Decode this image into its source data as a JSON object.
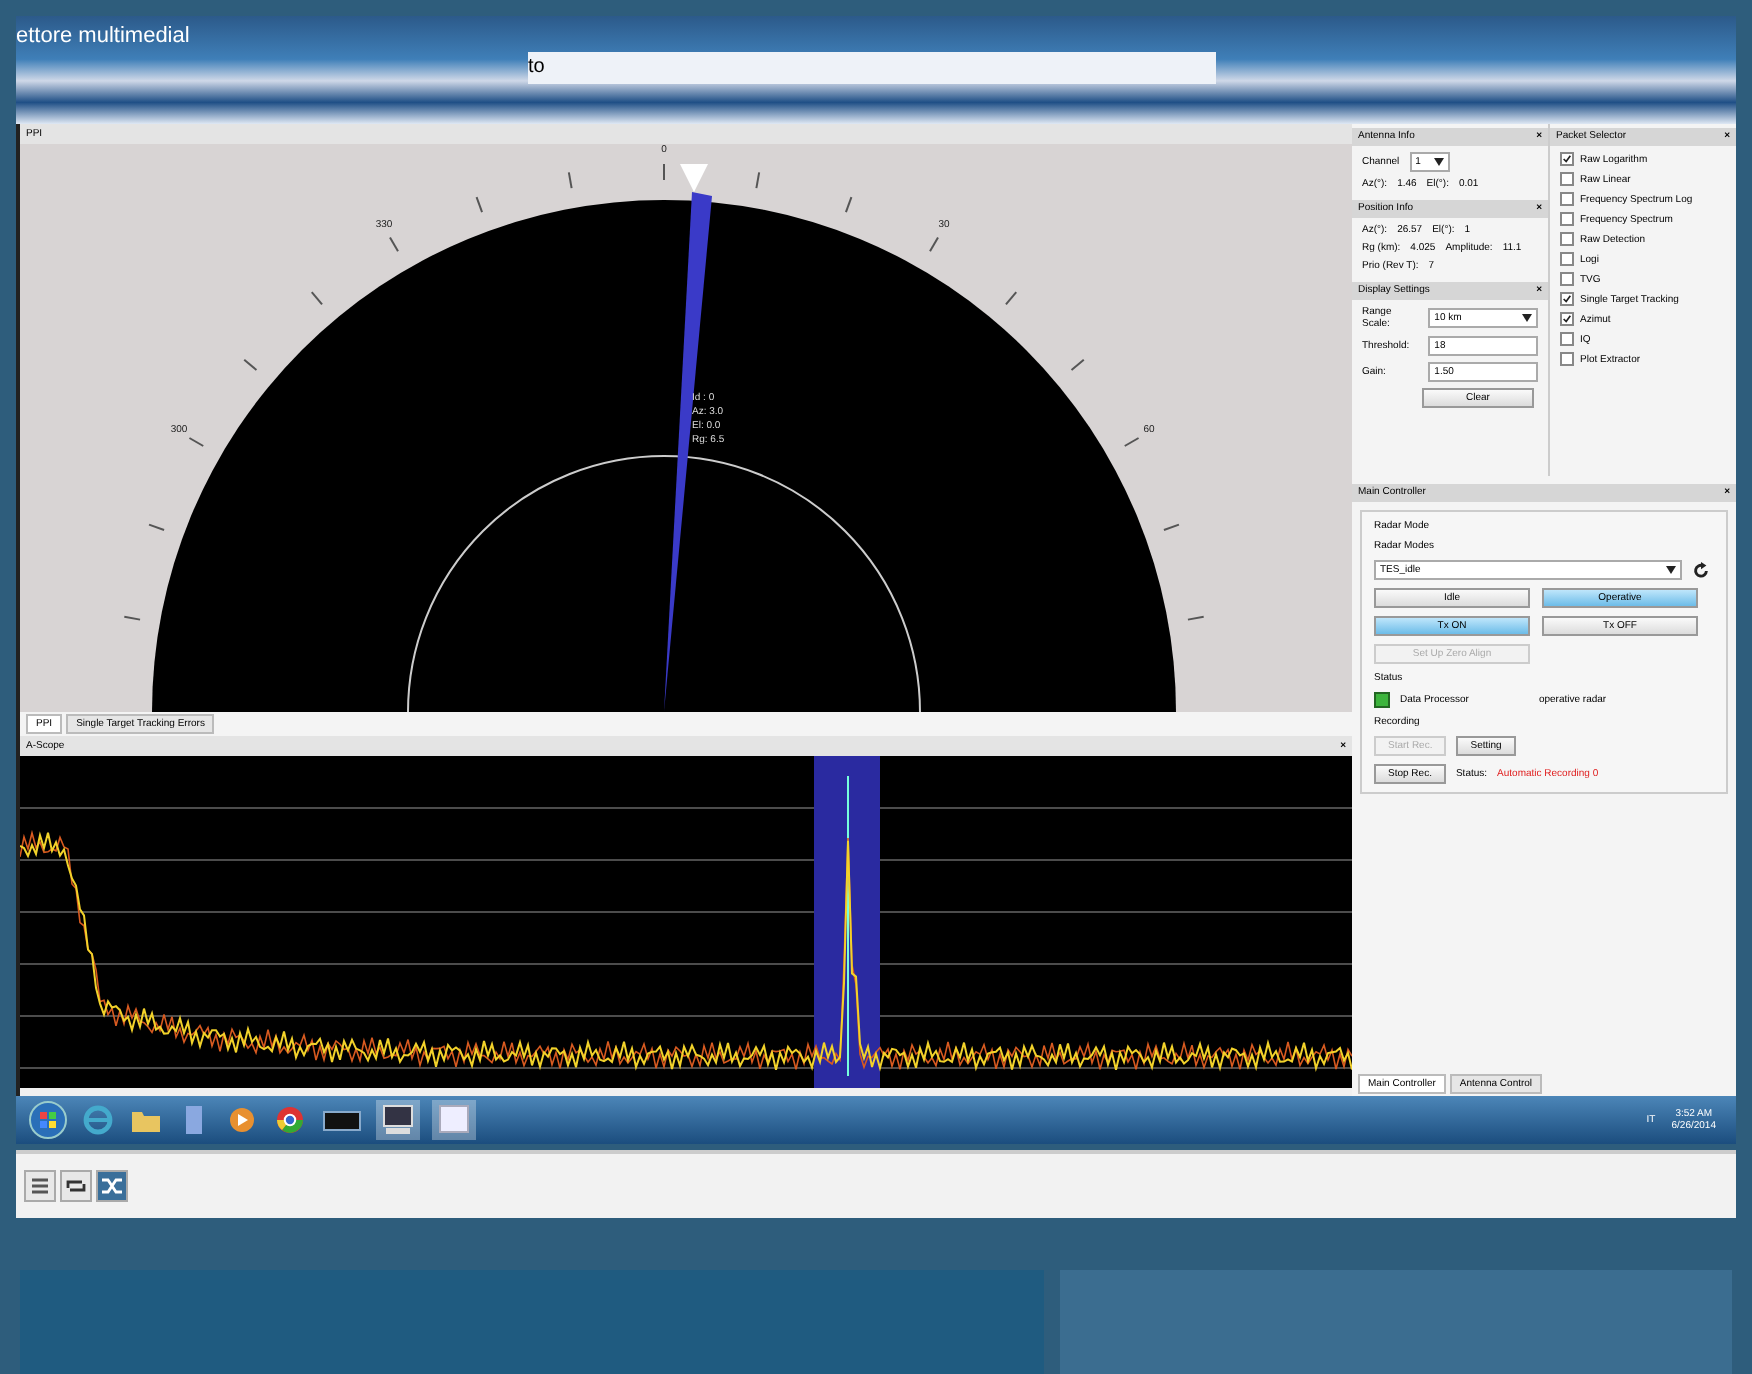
{
  "player": {
    "title": "ettore multimedial",
    "address": "to"
  },
  "ppi": {
    "title": "PPI",
    "bearings": [
      {
        "label": "0"
      },
      {
        "label": "330"
      },
      {
        "label": "30"
      },
      {
        "label": "300"
      },
      {
        "label": "60"
      }
    ],
    "target_info": [
      "Id : 0",
      "Az: 3.0",
      "El: 0.0",
      "Rg: 6.5"
    ],
    "tabs": [
      {
        "label": "PPI",
        "selected": true
      },
      {
        "label": "Single Target Tracking Errors",
        "selected": false
      }
    ]
  },
  "a_scope": {
    "title": "A-Scope",
    "close": "×"
  },
  "antenna_info": {
    "title": "Antenna Info",
    "close": "×",
    "channel_label": "Channel",
    "channel": "1",
    "az_label": "Az(°):",
    "az": "1.46",
    "el_label": "El(°):",
    "el": "0.01"
  },
  "position_info": {
    "title": "Position Info",
    "close": "×",
    "rows": [
      {
        "label": "Az(°):",
        "value": "26.57",
        "label2": "El(°):",
        "value2": "1"
      },
      {
        "label": "Rg (km):",
        "value": "4.025",
        "label2": "Amplitude:",
        "value2": "11.1"
      },
      {
        "label": "Prio (Rev T):",
        "value": "7",
        "label2": "",
        "value2": ""
      }
    ]
  },
  "display_settings": {
    "title": "Display Settings",
    "close": "×",
    "range_label": "Range Scale:",
    "range": "10 km",
    "threshold_label": "Threshold:",
    "threshold": "18",
    "gain_label": "Gain:",
    "gain": "1.50",
    "clear": "Clear"
  },
  "packet_selector": {
    "title": "Packet Selector",
    "close": "×",
    "items": [
      {
        "label": "Raw Logarithm",
        "checked": true
      },
      {
        "label": "Raw Linear",
        "checked": false
      },
      {
        "label": "Frequency Spectrum Log",
        "checked": false
      },
      {
        "label": "Frequency Spectrum",
        "checked": false
      },
      {
        "label": "Raw Detection",
        "checked": false
      },
      {
        "label": "Logi",
        "checked": false
      },
      {
        "label": "TVG",
        "checked": false
      },
      {
        "label": "Single Target Tracking",
        "checked": true
      },
      {
        "label": "Azimut",
        "checked": true
      },
      {
        "label": "IQ",
        "checked": false
      },
      {
        "label": "Plot Extractor",
        "checked": false
      }
    ]
  },
  "main_controller": {
    "title": "Main Controller",
    "close": "×",
    "group": "Radar Mode",
    "modes_label": "Radar Modes",
    "mode": "TES_idle",
    "buttons": [
      {
        "label": "Idle",
        "selected": false,
        "disabled": false
      },
      {
        "label": "Operative",
        "selected": true,
        "disabled": false
      },
      {
        "label": "Tx ON",
        "selected": true,
        "disabled": false
      },
      {
        "label": "Tx OFF",
        "selected": false,
        "disabled": false
      },
      {
        "label": "Set Up Zero Align",
        "selected": false,
        "disabled": true
      }
    ],
    "status_title": "Status",
    "status": {
      "label": "Data Processor",
      "color": "#3cb43c",
      "text": "operative radar"
    },
    "recording_title": "Recording",
    "rec_buttons": [
      {
        "label": "Start Rec.",
        "disabled": true
      },
      {
        "label": "Setting",
        "disabled": false
      },
      {
        "label": "Stop Rec.",
        "disabled": false
      }
    ],
    "rec_status_label": "Status:",
    "rec_status": "Automatic Recording 0"
  },
  "bottom_tabs": [
    {
      "label": "Main Controller",
      "selected": true
    },
    {
      "label": "Antenna Control",
      "selected": false
    }
  ],
  "taskbar": {
    "apps": [
      {
        "kind": "start"
      },
      {
        "kind": "browser"
      },
      {
        "kind": "folder"
      },
      {
        "kind": "document"
      },
      {
        "kind": "media"
      },
      {
        "kind": "chrome"
      },
      {
        "kind": "terminal"
      },
      {
        "kind": "monitor"
      },
      {
        "kind": "window"
      }
    ],
    "language": "IT",
    "time": "3:52 AM",
    "date": "6/26/2014"
  },
  "player_controls": [
    {
      "kind": "list",
      "selected": false
    },
    {
      "kind": "repeat",
      "selected": false
    },
    {
      "kind": "shuffle",
      "selected": true
    }
  ]
}
